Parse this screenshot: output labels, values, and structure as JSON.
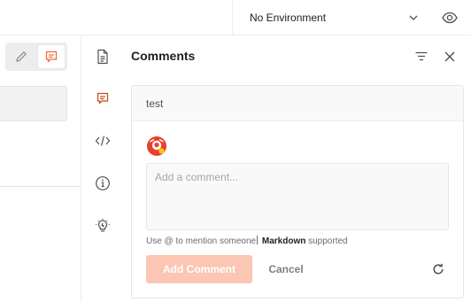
{
  "environment": {
    "selected": "No Environment",
    "chevron_icon": "chevron-down-icon",
    "preview_icon": "eye-icon"
  },
  "toolbar": {
    "edit_icon": "pencil-icon",
    "comment_icon": "comment-icon",
    "accent_color": "#f26b3a"
  },
  "rail": {
    "items": [
      {
        "name": "documentation",
        "icon": "document-icon"
      },
      {
        "name": "comments",
        "icon": "comment-icon",
        "active": true
      },
      {
        "name": "code",
        "icon": "code-icon"
      },
      {
        "name": "info",
        "icon": "info-icon"
      },
      {
        "name": "related",
        "icon": "lightbulb-icon"
      }
    ]
  },
  "comments": {
    "title": "Comments",
    "filter_icon": "filter-icon",
    "close_icon": "close-icon",
    "thread_title": "test",
    "input_placeholder": "Add a comment...",
    "hint_prefix": "Use @ to mention someone",
    "hint_markdown": "Markdown",
    "hint_suffix": "supported",
    "add_label": "Add Comment",
    "cancel_label": "Cancel",
    "refresh_icon": "refresh-icon",
    "add_button_color": "#fbc6b3"
  }
}
